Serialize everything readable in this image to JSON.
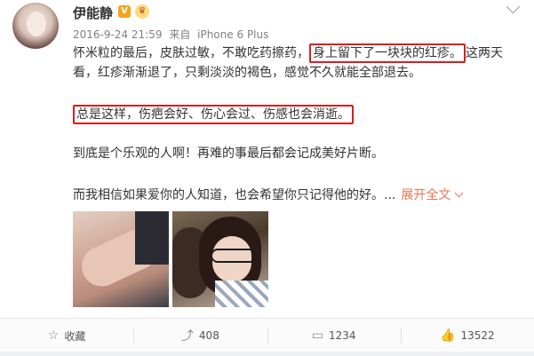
{
  "post": {
    "user_name": "伊能静",
    "badge_v": "V",
    "meta_time": "2016-9-24 21:59",
    "meta_from": "来自",
    "meta_device": "iPhone 6 Plus",
    "p1_before": "怀米粒的最后，皮肤过敏，不敢吃药擦药，",
    "p1_highlight": "身上留下了一块块的红疹。",
    "p1_after": "这两天看，红疹渐渐退了，只剩淡淡的褐色，感觉不久就能全部退去。",
    "p2_highlight": "总是这样，伤疤会好、伤心会过、伤感也会消逝。",
    "p3": "到底是个乐观的人啊！再难的事最后都会记成美好片断。",
    "p4": "而我相信如果爱你的人知道，也会希望你只记得他的好。...",
    "expand_label": "展开全文"
  },
  "actions": {
    "favorite_label": "收藏",
    "repost_count": "408",
    "comment_count": "1234",
    "like_count": "13522"
  },
  "colors": {
    "highlight_border": "#d81e1e",
    "expand": "#eb7350"
  }
}
